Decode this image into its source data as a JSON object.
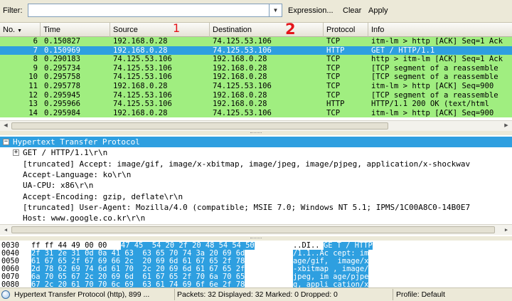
{
  "filter": {
    "label": "Filter:",
    "value": "",
    "expression_label": "Expression...",
    "clear_label": "Clear",
    "apply_label": "Apply"
  },
  "packet_list": {
    "columns": [
      "No.",
      "Time",
      "Source",
      "Destination",
      "Protocol",
      "Info"
    ],
    "sorted_column_indicator": "chevron-down-icon",
    "rows": [
      {
        "no": "6",
        "time": "0.150827",
        "source": "192.168.0.28",
        "destination": "74.125.53.106",
        "protocol": "TCP",
        "info": "itm-lm > http [ACK] Seq=1 Ack"
      },
      {
        "no": "7",
        "time": "0.150969",
        "source": "192.168.0.28",
        "destination": "74.125.53.106",
        "protocol": "HTTP",
        "info": "GET / HTTP/1.1"
      },
      {
        "no": "8",
        "time": "0.290183",
        "source": "74.125.53.106",
        "destination": "192.168.0.28",
        "protocol": "TCP",
        "info": "http > itm-lm [ACK] Seq=1 Ack"
      },
      {
        "no": "9",
        "time": "0.295734",
        "source": "74.125.53.106",
        "destination": "192.168.0.28",
        "protocol": "TCP",
        "info": "[TCP segment of a reassemble"
      },
      {
        "no": "10",
        "time": "0.295758",
        "source": "74.125.53.106",
        "destination": "192.168.0.28",
        "protocol": "TCP",
        "info": "[TCP segment of a reassemble"
      },
      {
        "no": "11",
        "time": "0.295778",
        "source": "192.168.0.28",
        "destination": "74.125.53.106",
        "protocol": "TCP",
        "info": "itm-lm > http [ACK] Seq=900"
      },
      {
        "no": "12",
        "time": "0.295945",
        "source": "74.125.53.106",
        "destination": "192.168.0.28",
        "protocol": "TCP",
        "info": "[TCP segment of a reassemble"
      },
      {
        "no": "13",
        "time": "0.295966",
        "source": "74.125.53.106",
        "destination": "192.168.0.28",
        "protocol": "HTTP",
        "info": "HTTP/1.1 200 OK  (text/html"
      },
      {
        "no": "14",
        "time": "0.295984",
        "source": "192.168.0.28",
        "destination": "74.125.53.106",
        "protocol": "TCP",
        "info": "itm-lm > http [ACK] Seq=900"
      }
    ],
    "selected_row": 1,
    "row_color": "#a0ee80",
    "selected_color": "#2e9fe0"
  },
  "details": {
    "lines": [
      {
        "text": "Hypertext Transfer Protocol",
        "expander": "−"
      },
      {
        "text": "GET / HTTP/1.1\\r\\n",
        "expander": "+"
      },
      {
        "text": "[truncated] Accept: image/gif, image/x-xbitmap, image/jpeg, image/pjpeg, application/x-shockwav"
      },
      {
        "text": "Accept-Language: ko\\r\\n"
      },
      {
        "text": "UA-CPU: x86\\r\\n"
      },
      {
        "text": "Accept-Encoding: gzip, deflate\\r\\n"
      },
      {
        "text": "[truncated] User-Agent: Mozilla/4.0 (compatible; MSIE 7.0; Windows NT 5.1; IPMS/1C00A8C0-14B0E7"
      },
      {
        "text": "Host: www.google.co.kr\\r\\n"
      }
    ]
  },
  "bytes": {
    "rows": [
      {
        "offset": "0030",
        "hex_a": "ff ff 44 49 00 00 ",
        "hex_b": "47 45  54 20 2f 20 48 54 54 50",
        "ascii_a": "..DI..",
        "ascii_b": "GE T / HTTP"
      },
      {
        "offset": "0040",
        "hex_a": "",
        "hex_b": "2f 31 2e 31 0d 0a 41 63  63 65 70 74 3a 20 69 6d",
        "ascii_a": "",
        "ascii_b": "/1.1..Ac cept: im"
      },
      {
        "offset": "0050",
        "hex_a": "",
        "hex_b": "61 67 65 2f 67 69 66 2c  20 69 6d 61 67 65 2f 78",
        "ascii_a": "",
        "ascii_b": "age/gif,  image/x"
      },
      {
        "offset": "0060",
        "hex_a": "",
        "hex_b": "2d 78 62 69 74 6d 61 70  2c 20 69 6d 61 67 65 2f",
        "ascii_a": "",
        "ascii_b": "-xbitmap , image/"
      },
      {
        "offset": "0070",
        "hex_a": "",
        "hex_b": "6a 70 65 67 2c 20 69 6d  61 67 65 2f 70 6a 70 65",
        "ascii_a": "",
        "ascii_b": "jpeg, im age/pjpe"
      },
      {
        "offset": "0080",
        "hex_a": "",
        "hex_b": "67 2c 20 61 70 70 6c 69  63 61 74 69 6f 6e 2f 78",
        "ascii_a": "",
        "ascii_b": "g, appli cation/x"
      }
    ]
  },
  "status": {
    "icon": "info-circle-icon",
    "protocol_text": "Hypertext Transfer Protocol (http), 899 ...",
    "packets_text": "Packets: 32 Displayed: 32 Marked: 0 Dropped: 0",
    "profile_text": "Profile: Default"
  },
  "annotations": {
    "mark_source": "1",
    "mark_destination": "2",
    "color": "#e4141a"
  }
}
